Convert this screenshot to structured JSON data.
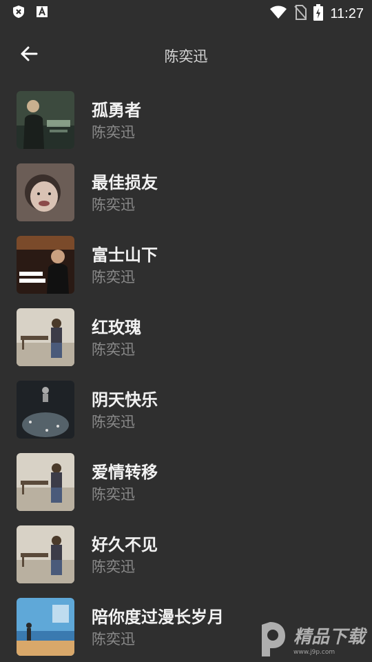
{
  "status_bar": {
    "time": "11:27",
    "icons": [
      "shield-x-icon",
      "font-a-icon",
      "wifi-icon",
      "no-sim-icon",
      "battery-charging-icon"
    ]
  },
  "header": {
    "title": "陈奕迅",
    "back_icon": "arrow-left-icon"
  },
  "songs": [
    {
      "title": "孤勇者",
      "artist": "陈奕迅"
    },
    {
      "title": "最佳损友",
      "artist": "陈奕迅"
    },
    {
      "title": "富士山下",
      "artist": "陈奕迅"
    },
    {
      "title": "红玫瑰",
      "artist": "陈奕迅"
    },
    {
      "title": "阴天快乐",
      "artist": "陈奕迅"
    },
    {
      "title": "爱情转移",
      "artist": "陈奕迅"
    },
    {
      "title": "好久不见",
      "artist": "陈奕迅"
    },
    {
      "title": "陪你度过漫长岁月",
      "artist": "陈奕迅"
    }
  ],
  "watermark": {
    "text": "精品下载",
    "url_text": "www.j9p.com"
  },
  "colors": {
    "background": "#2f2f2f",
    "title_text": "#f2f2f2",
    "subtitle_text": "#8a8a8a"
  }
}
